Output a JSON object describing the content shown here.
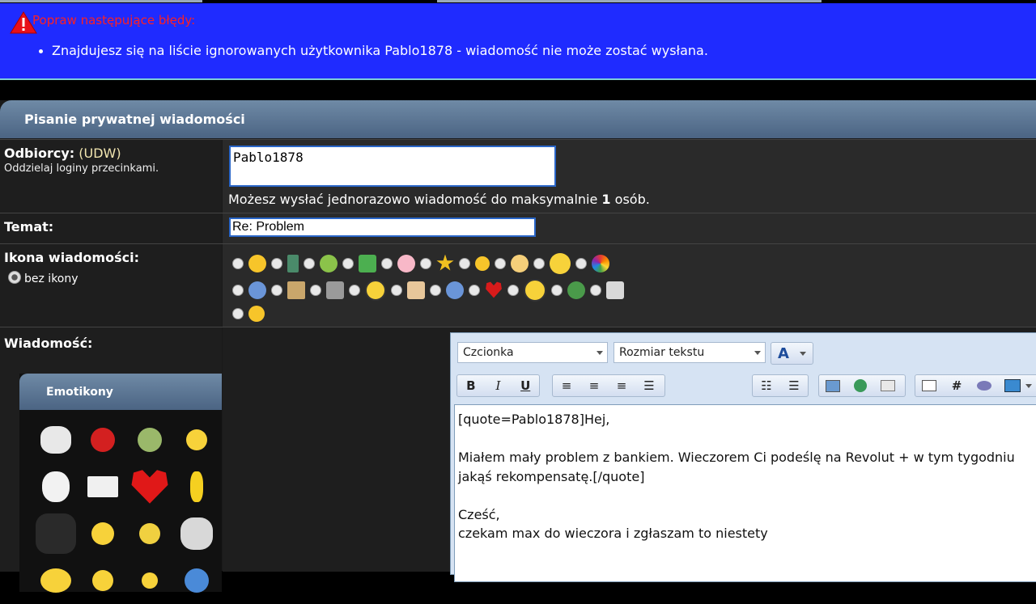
{
  "error": {
    "title": "Popraw następujące błędy:",
    "messages": [
      "Znajdujesz się na liście ignorowanych użytkownika Pablo1878 - wiadomość nie może zostać wysłana."
    ]
  },
  "panel": {
    "title": "Pisanie prywatnej wiadomości"
  },
  "recipients": {
    "label": "Odbiorcy:",
    "link": "(UDW)",
    "hint": "Oddzielaj loginy przecinkami.",
    "value": "Pablo1878",
    "max_prefix": "Możesz wysłać jednorazowo wiadomość do maksymalnie",
    "max_count": "1",
    "max_suffix": "osób."
  },
  "subject": {
    "label": "Temat:",
    "value": "Re: Problem"
  },
  "message_icon": {
    "label": "Ikona wiadomości:",
    "none_label": "bez ikony",
    "icons": [
      "smile",
      "film",
      "tongue",
      "thumbs-up",
      "pink-blob",
      "star",
      "smile-small",
      "sun-badge",
      "wink-big",
      "rainbow",
      "question",
      "picture",
      "music",
      "lightbulb",
      "cake",
      "info",
      "heart",
      "exclamation",
      "bug",
      "box",
      "grin"
    ]
  },
  "message": {
    "label": "Wiadomość:",
    "emoticons_title": "Emotikony",
    "emoticons": [
      "troll-face",
      "angry-red",
      "sick-green",
      "dizzy-yellow",
      "poker-face",
      "off-topic-sign",
      "big-heart",
      "banana",
      "fuck-yea",
      "dancing-smiley",
      "nerd-glasses",
      "rage-face",
      "laughing-yellow",
      "grin-yellow",
      "smile-small",
      "sad-blue"
    ],
    "font_select": "Czcionka",
    "size_select": "Rozmiar tekstu",
    "body": "[quote=Pablo1878]Hej,\n\nMiałem mały problem z bankiem. Wieczorem Ci podeślę na Revolut + w tym tygodniu jakąś rekompensatę.[/quote]\n\nCześć,\nczekam max do wieczora i zgłaszam to niestety"
  },
  "colors": {
    "error_bg": "#1f2bff",
    "error_title": "#ff2020",
    "header_gradient_top": "#6f8aa6",
    "header_gradient_bottom": "#4b6483",
    "udw": "#f2e6b0"
  }
}
